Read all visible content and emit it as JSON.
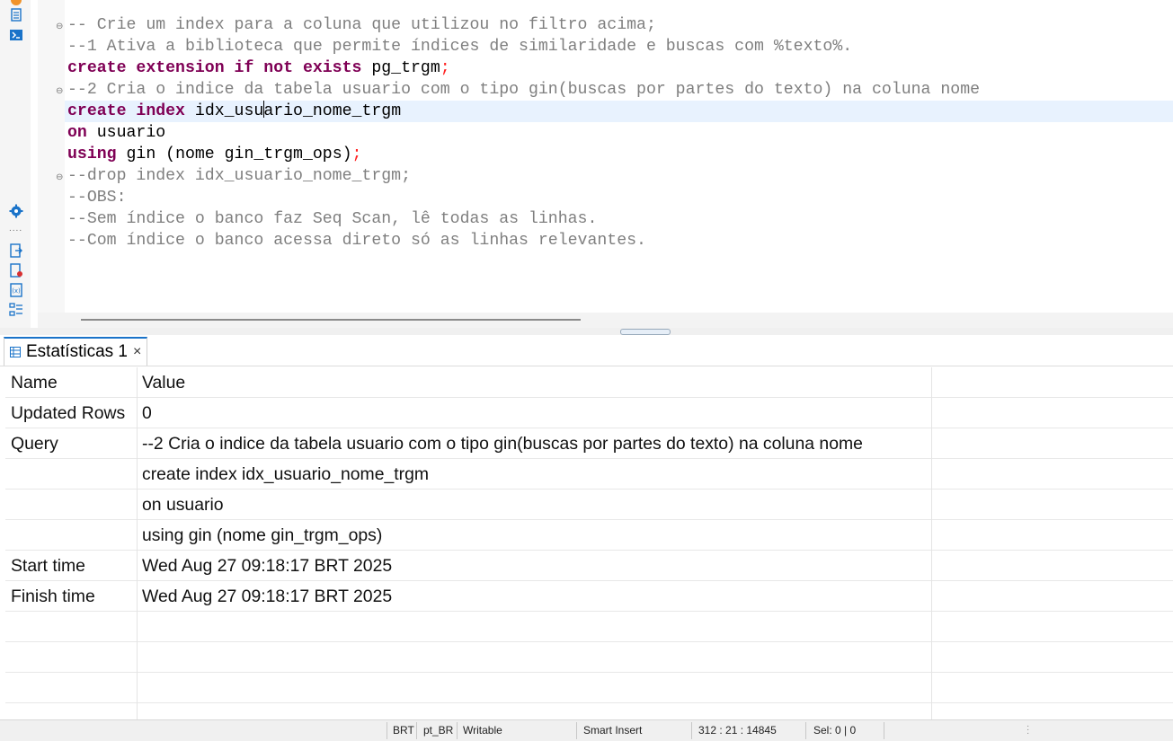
{
  "editor": {
    "lines": [
      {
        "fold": true,
        "current": false,
        "tokens": [
          {
            "t": "cmt",
            "v": "-- Crie um index para a coluna que utilizou no filtro acima;"
          }
        ]
      },
      {
        "fold": false,
        "current": false,
        "tokens": [
          {
            "t": "cmt",
            "v": "--1 Ativa a biblioteca que permite índices de similaridade e buscas com %texto%."
          }
        ]
      },
      {
        "fold": false,
        "current": false,
        "tokens": [
          {
            "t": "kw",
            "v": "create extension if not exists"
          },
          {
            "t": "txt",
            "v": " pg_trgm"
          },
          {
            "t": "semi",
            "v": ";"
          }
        ]
      },
      {
        "fold": true,
        "current": false,
        "tokens": [
          {
            "t": "cmt",
            "v": "--2 Cria o indice da tabela usuario com o tipo gin(buscas por partes do texto) na coluna nome"
          }
        ]
      },
      {
        "fold": false,
        "current": true,
        "tokens": [
          {
            "t": "kw",
            "v": "create index"
          },
          {
            "t": "txt",
            "v": " idx_usu"
          },
          {
            "t": "caret",
            "v": ""
          },
          {
            "t": "txt",
            "v": "ario_nome_trgm"
          }
        ]
      },
      {
        "fold": false,
        "current": false,
        "tokens": [
          {
            "t": "kw",
            "v": "on"
          },
          {
            "t": "txt",
            "v": " usuario"
          }
        ]
      },
      {
        "fold": false,
        "current": false,
        "tokens": [
          {
            "t": "kw",
            "v": "using"
          },
          {
            "t": "txt",
            "v": " gin (nome gin_trgm_ops)"
          },
          {
            "t": "semi",
            "v": ";"
          }
        ]
      },
      {
        "fold": true,
        "current": false,
        "tokens": [
          {
            "t": "cmt",
            "v": "--drop index idx_usuario_nome_trgm;"
          }
        ]
      },
      {
        "fold": false,
        "current": false,
        "tokens": [
          {
            "t": "cmt",
            "v": "--OBS:"
          }
        ]
      },
      {
        "fold": false,
        "current": false,
        "tokens": [
          {
            "t": "cmt",
            "v": "--Sem índice o banco faz Seq Scan, lê todas as linhas."
          }
        ]
      },
      {
        "fold": false,
        "current": false,
        "tokens": [
          {
            "t": "cmt",
            "v": "--Com índice o banco acessa direto só as linhas relevantes."
          }
        ]
      }
    ]
  },
  "results": {
    "tab_label": "Estatísticas 1",
    "close_glyph": "×",
    "header": {
      "name": "Name",
      "value": "Value"
    },
    "rows": [
      {
        "name": "Updated Rows",
        "value": "0"
      },
      {
        "name": "Query",
        "value": "--2 Cria o indice da tabela usuario com o tipo gin(buscas por partes do texto) na coluna nome"
      },
      {
        "name": "",
        "value": "create index idx_usuario_nome_trgm"
      },
      {
        "name": "",
        "value": "on usuario"
      },
      {
        "name": "",
        "value": "using gin (nome gin_trgm_ops)"
      },
      {
        "name": "Start time",
        "value": "Wed Aug 27 09:18:17 BRT 2025"
      },
      {
        "name": "Finish time",
        "value": "Wed Aug 27 09:18:17 BRT 2025"
      },
      {
        "name": "",
        "value": ""
      },
      {
        "name": "",
        "value": ""
      },
      {
        "name": "",
        "value": ""
      }
    ]
  },
  "statusbar": {
    "timezone": "BRT",
    "locale": "pt_BR",
    "mode": "Writable",
    "insert_mode": "Smart Insert",
    "position": "312 : 21 : 14845",
    "selection": "Sel: 0 | 0"
  },
  "colors": {
    "keyword": "#7f0055",
    "comment": "#7f7f7f",
    "semicolon": "#ff2020",
    "current_line": "#e8f2fe",
    "tab_accent": "#1a73c9"
  }
}
